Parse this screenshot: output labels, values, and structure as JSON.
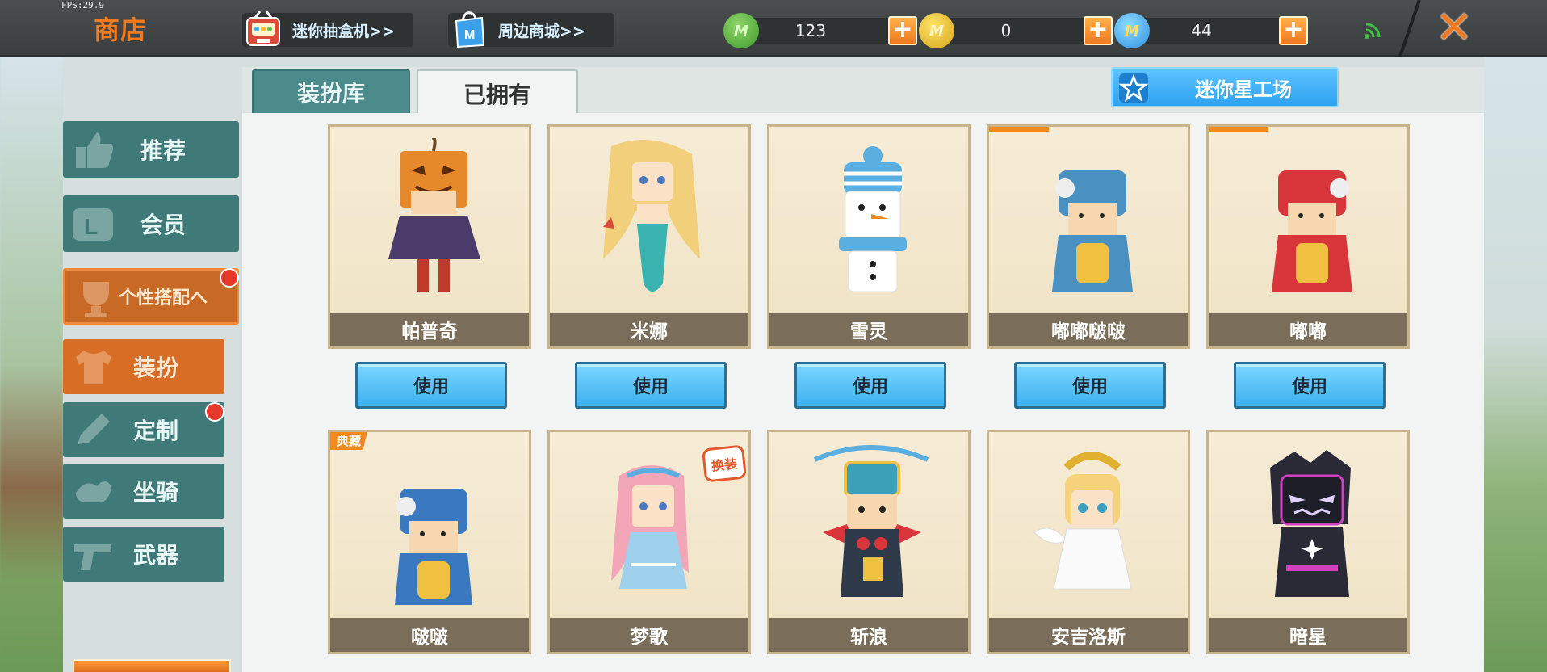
{
  "fps": "FPS:29.9",
  "header": {
    "title": "商店",
    "gacha_label": "迷你抽盒机>>",
    "mall_label": "周边商城>>"
  },
  "currencies": [
    {
      "name": "mini-bean",
      "value": "123",
      "icon": "green-coin-icon"
    },
    {
      "name": "mini-coin",
      "value": "0",
      "icon": "gold-coin-icon"
    },
    {
      "name": "mini-point",
      "value": "44",
      "icon": "blue-coin-icon"
    }
  ],
  "plus_label": "+",
  "close_label": "✕",
  "tabs": [
    {
      "label": "装扮库",
      "active": false
    },
    {
      "label": "已拥有",
      "active": true
    }
  ],
  "star_factory_label": "迷你星工场",
  "sidebar": {
    "items": [
      {
        "label": "推荐"
      },
      {
        "label": "会员"
      },
      {
        "label": "个性搭配へ"
      },
      {
        "label": "装扮"
      },
      {
        "label": "定制"
      },
      {
        "label": "坐骑"
      },
      {
        "label": "武器"
      }
    ]
  },
  "use_label": "使用",
  "skins_row1": [
    {
      "name": "帕普奇",
      "ribbon": ""
    },
    {
      "name": "米娜",
      "ribbon": ""
    },
    {
      "name": "雪灵",
      "ribbon": ""
    },
    {
      "name": "嘟嘟啵啵",
      "ribbon": ""
    },
    {
      "name": "嘟嘟",
      "ribbon": ""
    }
  ],
  "skins_row2": [
    {
      "name": "啵啵",
      "ribbon": "典藏"
    },
    {
      "name": "梦歌",
      "badge": "换装"
    },
    {
      "name": "斩浪",
      "ribbon": ""
    },
    {
      "name": "安吉洛斯",
      "ribbon": ""
    },
    {
      "name": "暗星",
      "ribbon": ""
    }
  ],
  "colors": {
    "accent_orange": "#f07a1f",
    "teal": "#3f7a78",
    "use_button_blue": "#3cb0f0"
  }
}
